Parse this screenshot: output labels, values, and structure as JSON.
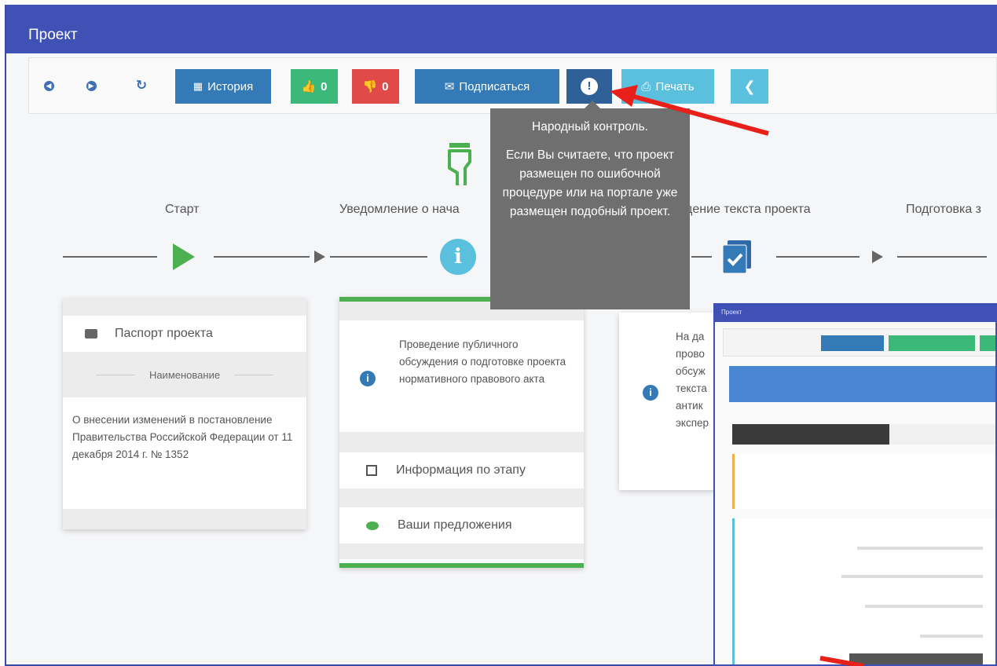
{
  "window": {
    "title": "Проект"
  },
  "toolbar": {
    "history_label": "История",
    "likes_count": "0",
    "dislikes_count": "0",
    "subscribe_label": "Подписаться",
    "print_label": "Печать",
    "colors": {
      "blue": "#337ab7",
      "green": "#3cb878",
      "red": "#e04b4a",
      "navy": "#2f6097",
      "light_blue": "#5bc0de"
    }
  },
  "tooltip": {
    "title": "Народный контроль.",
    "body": "Если Вы считаете, что проект размещен по ошибочной процедуре или на портале уже размещен подобный проект."
  },
  "steps": {
    "start": "Старт",
    "notice": "Уведомление о нача",
    "text": "дение текста проекта",
    "prep": "Подготовка з"
  },
  "passport": {
    "heading": "Паспорт проекта",
    "subheading": "Наименование",
    "name": "О внесении изменений в постановление Правительства Российской Федерации от 11 декабря 2014 г. № 1352"
  },
  "notice_card": {
    "description": "Проведение публичного обсуждения о подготовке проекта нормативного правового акта",
    "info_label": "Информация по этапу",
    "proposals_label": "Ваши предложения"
  },
  "text_card": {
    "description_lines": [
      "На да",
      "прово",
      "обсуж",
      "текста",
      "антик",
      "экспер"
    ]
  },
  "inset": {
    "title": "Проект"
  }
}
